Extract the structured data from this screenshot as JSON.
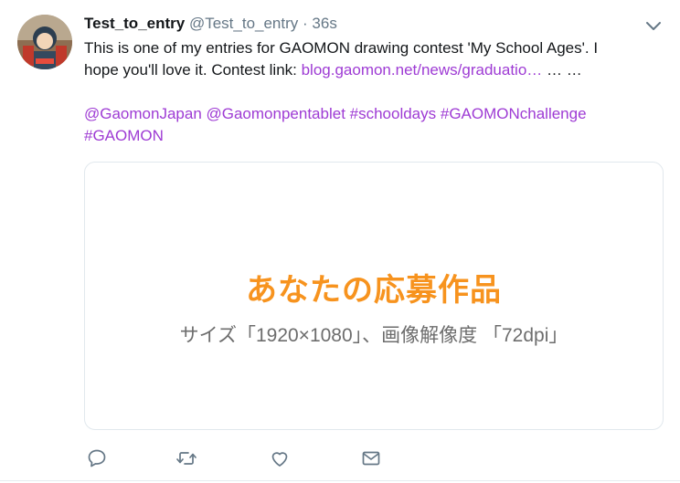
{
  "tweet": {
    "display_name": "Test_to_entry",
    "handle": "@Test_to_entry",
    "separator": "·",
    "timestamp": "36s",
    "text_line1": "This is one of my entries for GAOMON drawing contest 'My School Ages'. I",
    "text_line2_prefix": "hope you'll love it. Contest link: ",
    "link_text": "blog.gaomon.net/news/graduatio…",
    "text_line2_suffix": " … …",
    "hashtags_line1": "@GaomonJapan @Gaomonpentablet #schooldays #GAOMONchallenge",
    "hashtags_line2": "#GAOMON"
  },
  "card": {
    "title": "あなたの応募作品",
    "subtitle": "サイズ「1920×1080」、画像解像度 「72dpi」"
  },
  "actions": {
    "icons": [
      "reply-icon",
      "retweet-icon",
      "like-icon",
      "dm-icon"
    ]
  },
  "colors": {
    "link": "#9e3bd4",
    "card_title": "#f7931e",
    "muted": "#657786"
  }
}
